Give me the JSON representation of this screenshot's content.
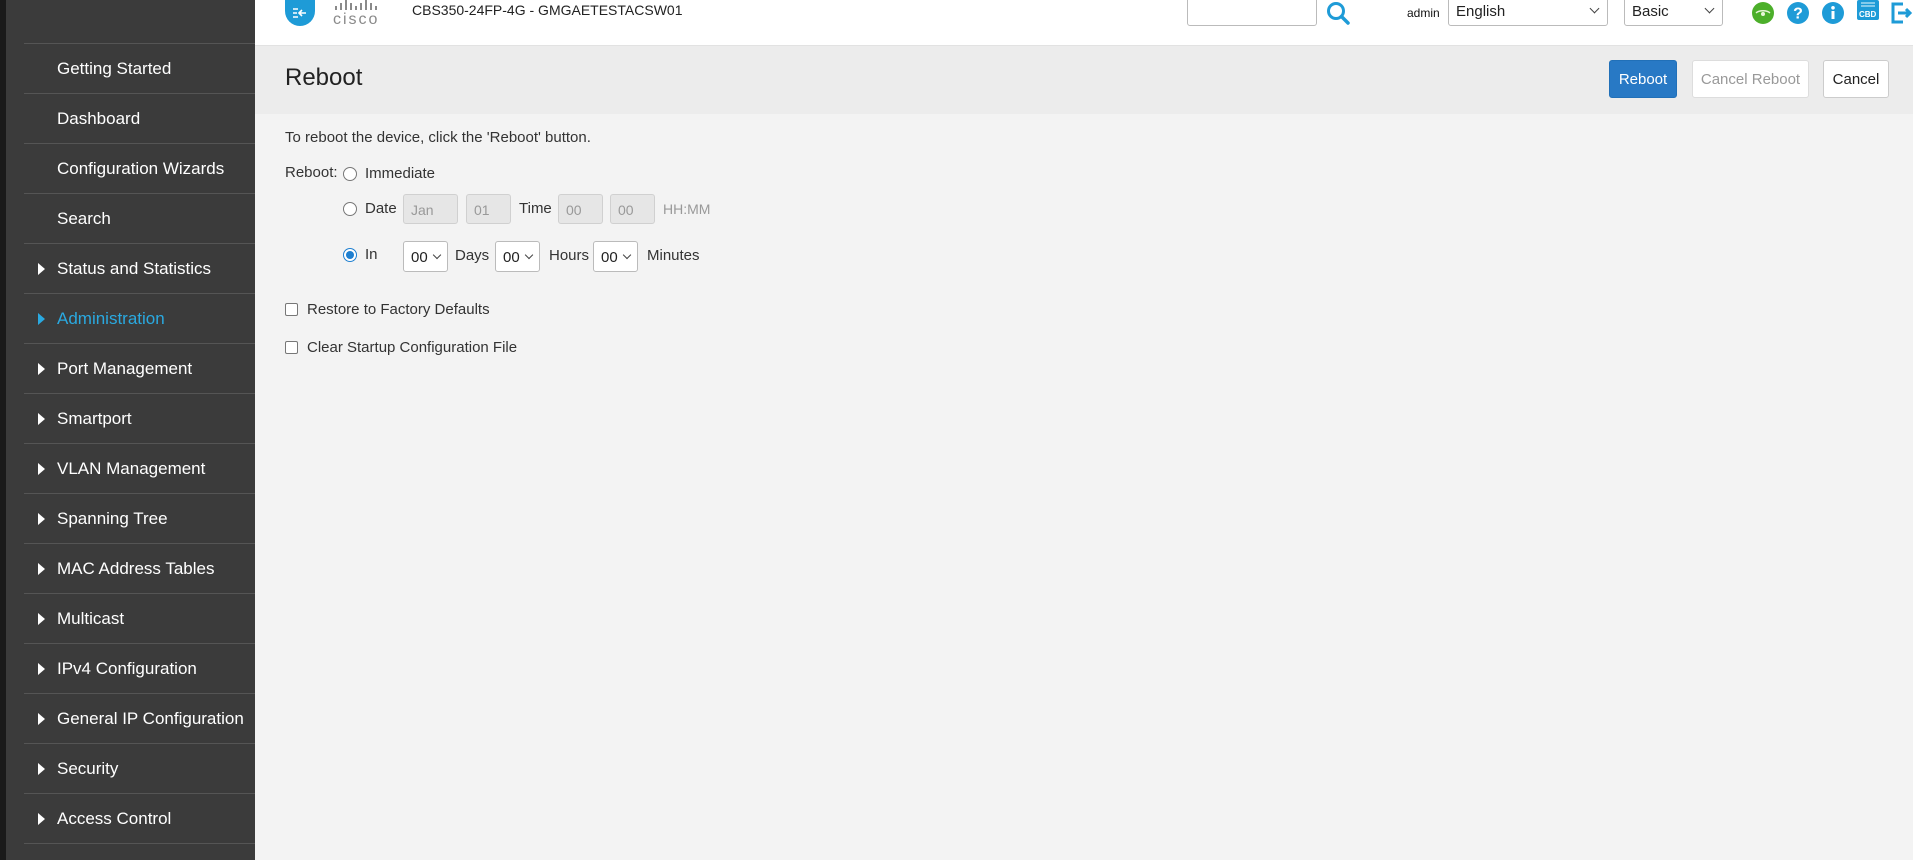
{
  "header": {
    "logo_text": "cisco",
    "device_name": "CBS350-24FP-4G - GMGAETESTACSW01",
    "search_value": "",
    "user": "admin",
    "language": "English",
    "mode": "Basic",
    "save_icon_text": "CBD"
  },
  "sidebar": {
    "items": [
      {
        "label": "Getting Started",
        "expandable": false
      },
      {
        "label": "Dashboard",
        "expandable": false
      },
      {
        "label": "Configuration Wizards",
        "expandable": false
      },
      {
        "label": "Search",
        "expandable": false
      },
      {
        "label": "Status and Statistics",
        "expandable": true
      },
      {
        "label": "Administration",
        "expandable": true,
        "active": true
      },
      {
        "label": "Port Management",
        "expandable": true
      },
      {
        "label": "Smartport",
        "expandable": true
      },
      {
        "label": "VLAN Management",
        "expandable": true
      },
      {
        "label": "Spanning Tree",
        "expandable": true
      },
      {
        "label": "MAC Address Tables",
        "expandable": true
      },
      {
        "label": "Multicast",
        "expandable": true
      },
      {
        "label": "IPv4 Configuration",
        "expandable": true
      },
      {
        "label": "General IP Configuration",
        "expandable": true
      },
      {
        "label": "Security",
        "expandable": true
      },
      {
        "label": "Access Control",
        "expandable": true
      }
    ]
  },
  "page": {
    "title": "Reboot",
    "buttons": {
      "reboot": "Reboot",
      "cancel_reboot": "Cancel Reboot",
      "cancel": "Cancel"
    },
    "instruction": "To reboot the device, click the 'Reboot' button.",
    "reboot_label": "Reboot:",
    "options": {
      "immediate": "Immediate",
      "date": "Date",
      "date_month": "Jan",
      "date_day": "01",
      "time": "Time",
      "time_hour": "00",
      "time_minute": "00",
      "time_format": "HH:MM",
      "in": "In",
      "in_days": "00",
      "days": "Days",
      "in_hours": "00",
      "hours": "Hours",
      "in_minutes": "00",
      "minutes": "Minutes",
      "selected": "in"
    },
    "restore_factory": "Restore to Factory Defaults",
    "clear_startup": "Clear Startup Configuration File"
  },
  "colors": {
    "accent": "#1e9bd7",
    "primary_button": "#2879c5",
    "sidebar_bg": "#3b3b3b",
    "active_nav": "#2aa9e0"
  }
}
